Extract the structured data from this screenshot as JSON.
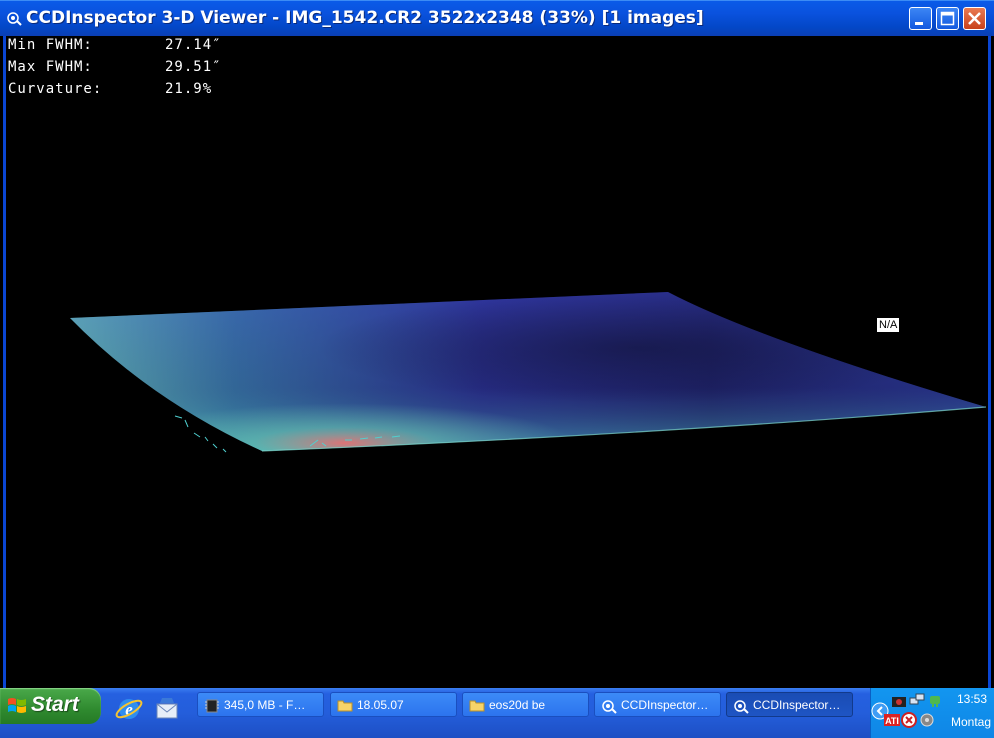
{
  "window": {
    "title": "CCDInspector 3-D Viewer - IMG_1542.CR2 3522x2348 (33%)  [1 images]",
    "icon": "ccdinspector-app-icon"
  },
  "stats": [
    {
      "label": "Min FWHM:",
      "value": "27.14″"
    },
    {
      "label": "Max FWHM:",
      "value": "29.51″"
    },
    {
      "label": "Curvature:",
      "value": "21.9%"
    }
  ],
  "plot": {
    "surface": "3-D FWHM surface",
    "na_label": "N/A",
    "colors": {
      "high": "#2a2f9a",
      "low": "#3ec3b0",
      "corner": "#e06060"
    }
  },
  "taskbar": {
    "start_label": "Start",
    "quick_launch": [
      "internet-explorer-icon",
      "outlook-express-icon"
    ],
    "tasks": [
      {
        "label": "345,0 MB - F…",
        "icon": "memory-chip-icon",
        "active": false
      },
      {
        "label": "18.05.07",
        "icon": "folder-icon",
        "active": false
      },
      {
        "label": "eos20d be",
        "icon": "folder-icon",
        "active": false
      },
      {
        "label": "CCDInspector…",
        "icon": "ccdinspector-app-icon",
        "active": false
      },
      {
        "label": "CCDInspector…",
        "icon": "ccdinspector-app-icon",
        "active": true
      }
    ],
    "tray": {
      "time": "13:53",
      "day": "Montag"
    }
  }
}
